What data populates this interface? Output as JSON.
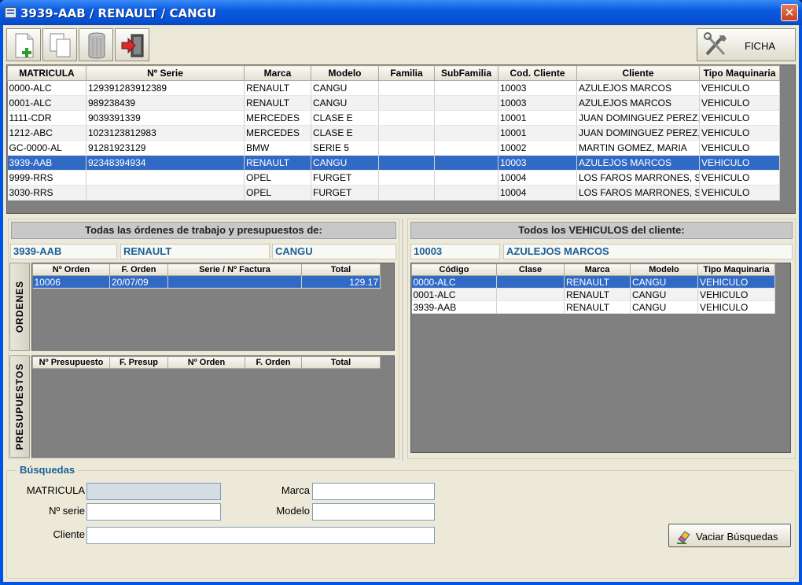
{
  "window": {
    "title": "3939-AAB / RENAULT / CANGU",
    "close_glyph": "✕"
  },
  "toolbar": {
    "icons": [
      "new-document-icon",
      "copy-icon",
      "trash-icon",
      "exit-icon"
    ],
    "ficha_label": "FICHA",
    "ficha_icon": "tools-icon"
  },
  "main_grid": {
    "columns": [
      "MATRICULA",
      "Nº Serie",
      "Marca",
      "Modelo",
      "Familia",
      "SubFamilia",
      "Cod. Cliente",
      "Cliente",
      "Tipo Maquinaria"
    ],
    "rows": [
      [
        "0000-ALC",
        "129391283912389",
        "RENAULT",
        "CANGU",
        "",
        "",
        "10003",
        "AZULEJOS MARCOS",
        "VEHICULO"
      ],
      [
        "0001-ALC",
        "989238439",
        "RENAULT",
        "CANGU",
        "",
        "",
        "10003",
        "AZULEJOS MARCOS",
        "VEHICULO"
      ],
      [
        "1111-CDR",
        "9039391339",
        "MERCEDES",
        "CLASE E",
        "",
        "",
        "10001",
        "JUAN DOMINGUEZ PEREZ,",
        "VEHICULO"
      ],
      [
        "1212-ABC",
        "1023123812983",
        "MERCEDES",
        "CLASE E",
        "",
        "",
        "10001",
        "JUAN DOMINGUEZ PEREZ,",
        "VEHICULO"
      ],
      [
        "GC-0000-AL",
        "91281923129",
        "BMW",
        "SERIE 5",
        "",
        "",
        "10002",
        "MARTIN GOMEZ, MARIA",
        "VEHICULO"
      ],
      [
        "3939-AAB",
        "92348394934",
        "RENAULT",
        "CANGU",
        "",
        "",
        "10003",
        "AZULEJOS MARCOS",
        "VEHICULO"
      ],
      [
        "9999-RRS",
        "",
        "OPEL",
        "FURGET",
        "",
        "",
        "10004",
        "LOS FAROS MARRONES, S",
        "VEHICULO"
      ],
      [
        "3030-RRS",
        "",
        "OPEL",
        "FURGET",
        "",
        "",
        "10004",
        "LOS FAROS MARRONES, S",
        "VEHICULO"
      ]
    ],
    "selected_row": 5
  },
  "orders_panel": {
    "header": "Todas las órdenes de trabajo y presupuestos de:",
    "matricula": "3939-AAB",
    "marca": "RENAULT",
    "modelo": "CANGU",
    "ordenes_tab": "ORDENES",
    "ordenes_columns": [
      "Nº Orden",
      "F. Orden",
      "Serie  /  Nº Factura",
      "Total"
    ],
    "ordenes_rows": [
      [
        "10006",
        "20/07/09",
        "",
        "129.17"
      ]
    ],
    "presupuestos_tab": "PRESUPUESTOS",
    "presupuestos_columns": [
      "Nº Presupuesto",
      "F. Presup",
      "Nº Orden",
      "F. Orden",
      "Total"
    ]
  },
  "vehicles_panel": {
    "header": "Todos los VEHICULOS del cliente:",
    "cod_cliente": "10003",
    "cliente": "AZULEJOS MARCOS",
    "columns": [
      "Código",
      "Clase",
      "Marca",
      "Modelo",
      "Tipo Maquinaria"
    ],
    "rows": [
      [
        "0000-ALC",
        "",
        "RENAULT",
        "CANGU",
        "VEHICULO"
      ],
      [
        "0001-ALC",
        "",
        "RENAULT",
        "CANGU",
        "VEHICULO"
      ],
      [
        "3939-AAB",
        "",
        "RENAULT",
        "CANGU",
        "VEHICULO"
      ]
    ],
    "selected_row": 0
  },
  "search": {
    "title": "Búsquedas",
    "matricula_label": "MATRICULA",
    "serie_label": "Nº serie",
    "cliente_label": "Cliente",
    "marca_label": "Marca",
    "modelo_label": "Modelo",
    "matricula_value": "",
    "serie_value": "",
    "cliente_value": "",
    "marca_value": "",
    "modelo_value": "",
    "clear_button_label": "Vaciar Búsquedas",
    "clear_icon": "eraser-icon"
  }
}
